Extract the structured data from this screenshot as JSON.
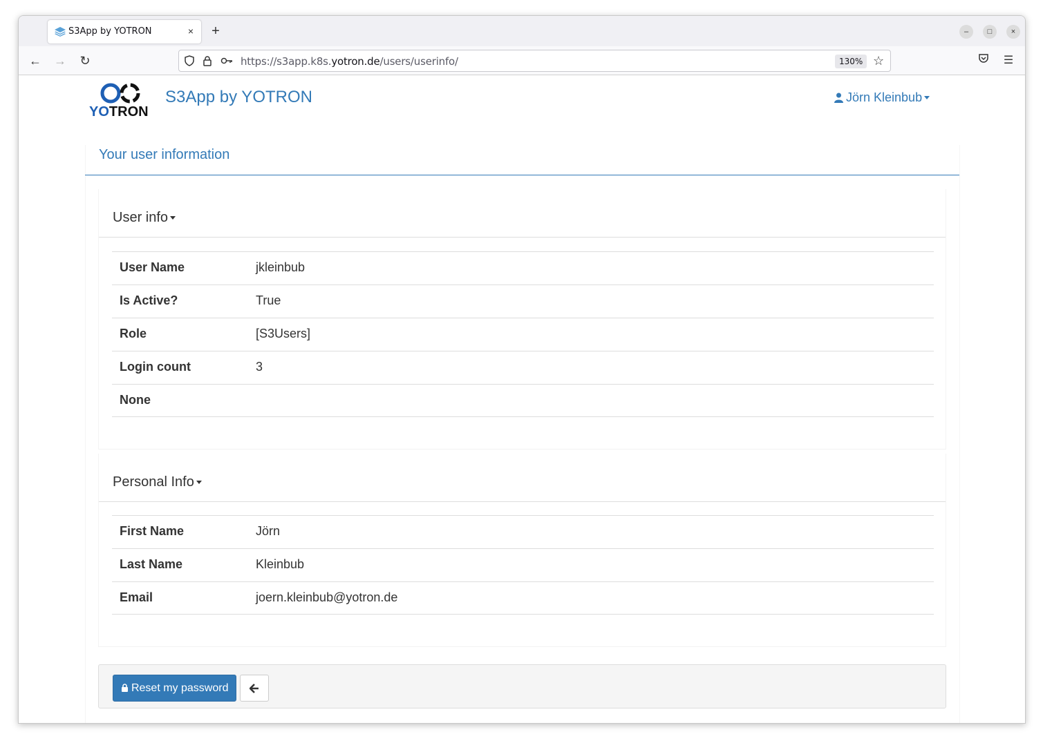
{
  "browser": {
    "tab_title": "S3App by YOTRON",
    "tab_close": "×",
    "new_tab": "+",
    "url_prefix": "https://s3app.k8s.",
    "url_domain": "yotron.de",
    "url_path": "/users/userinfo/",
    "zoom": "130%",
    "minimize": "–",
    "maximize": "□",
    "close": "×"
  },
  "app": {
    "logo_text": "YOTRON",
    "title": "S3App by YOTRON",
    "user_name": "Jörn Kleinbub",
    "accent_color": "#337ab7"
  },
  "page": {
    "heading": "Your user information"
  },
  "user_info": {
    "title": "User info",
    "rows": [
      {
        "key": "User Name",
        "value": "jkleinbub"
      },
      {
        "key": "Is Active?",
        "value": "True"
      },
      {
        "key": "Role",
        "value": "[S3Users]"
      },
      {
        "key": "Login count",
        "value": "3"
      },
      {
        "key": "None",
        "value": ""
      }
    ]
  },
  "personal_info": {
    "title": "Personal Info",
    "rows": [
      {
        "key": "First Name",
        "value": "Jörn"
      },
      {
        "key": "Last Name",
        "value": "Kleinbub"
      },
      {
        "key": "Email",
        "value": "joern.kleinbub@yotron.de"
      }
    ]
  },
  "actions": {
    "reset_label": "Reset my password",
    "back_label": "🡐"
  }
}
